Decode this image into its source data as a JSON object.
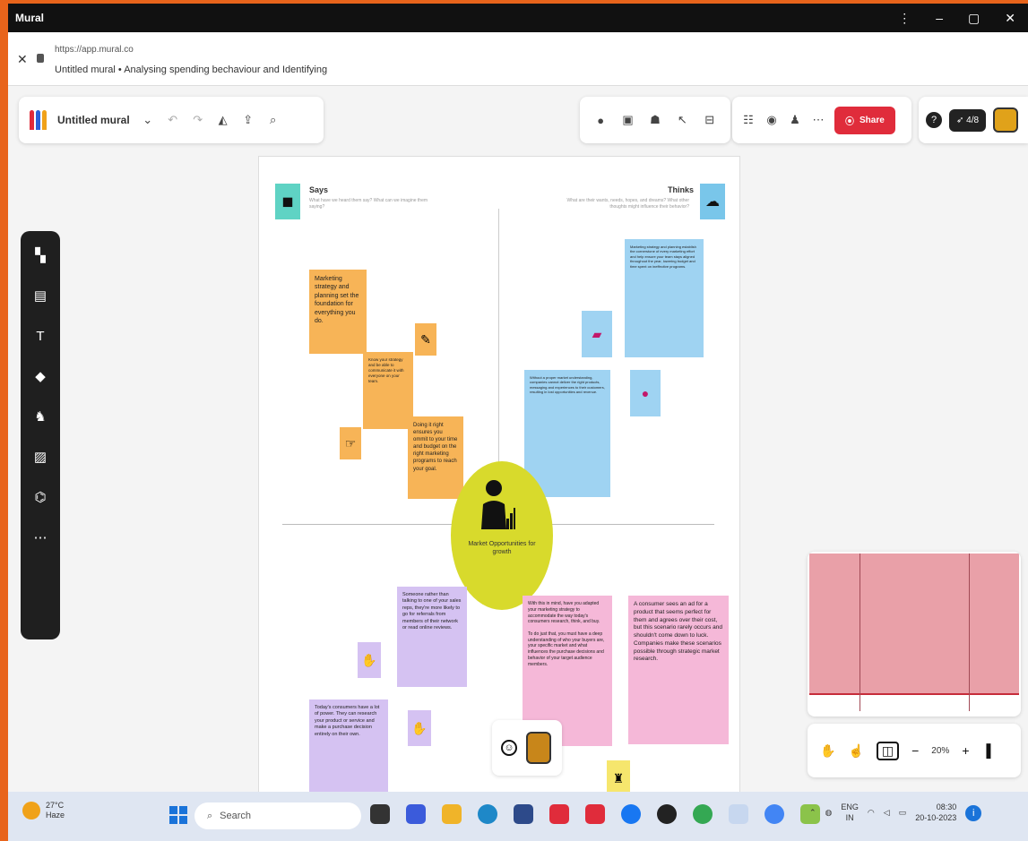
{
  "window": {
    "title": "Mural",
    "controls": [
      "⋮",
      "–",
      "▢",
      "✕"
    ]
  },
  "browser": {
    "url": "https://app.mural.co",
    "page_title": "Untitled mural • Analysing spending bechaviour and Identifying"
  },
  "toolbar": {
    "mural_name": "Untitled mural",
    "share_label": "Share",
    "timer_label": "4/8"
  },
  "board": {
    "says": {
      "title": "Says",
      "subtitle": "What have we heard them say? What can we imagine them saying?"
    },
    "thinks": {
      "title": "Thinks",
      "subtitle": "What are their wants, needs, hopes, and dreams? What other thoughts might influence their behavior?"
    },
    "center_label": "Market Opportunities for growth",
    "stickies": {
      "o1": "Marketing strategy and planning set the foundation for everything you do.",
      "o2": "Know your strategy and be able to communicate it with everyone on your team.",
      "o3": "Doing it right ensures you ommit to your time and budget on the right marketing programs to reach your goal.",
      "b1": "Marketing strategy and planning establish the cornerstone of every marketing effort and help ensure your team stays aligned throughout the year, lowering budget and time spent on ineffective programs.",
      "b2": "Without a proper market understanding, companies cannot deliver the right products, messaging and experiences to their customers, resulting in lost opportunities and revenue.",
      "p1": "Someone rather than talking to one of your sales reps, they're more likely to go for referrals from members of their network or read online reviews.",
      "p2": "Today's consumers have a lot of power. They can research your product or service and make a purchase decision entirely on their own.",
      "k1": "With this in mind, have you adapted your marketing strategy to accommodate the way today's consumers research, think, and buy.\n\nTo do just that, you must have a deep understanding of who your buyers are, your specific market and what influences the purchase decisions and behavior of your target audience members.",
      "k2": "A consumer sees an ad for a product that seems perfect for them and agrees over their cost, but this scenario rarely occurs and shouldn't come down to luck. Companies make these scenarios possible through strategic market research."
    }
  },
  "zoom": {
    "level": "20%"
  },
  "taskbar": {
    "weather_temp": "27°C",
    "weather_desc": "Haze",
    "search_placeholder": "Search",
    "lang_top": "ENG",
    "lang_bottom": "IN",
    "time": "08:30",
    "date": "20-10-2023"
  },
  "colors": {
    "accent_red": "#e02c3b",
    "orange_sticky": "#f7b457",
    "blue_sticky": "#9fd3f2",
    "purple_sticky": "#d5c2f2",
    "pink_sticky": "#f5b8d8",
    "center_yellow": "#d8da2c"
  }
}
